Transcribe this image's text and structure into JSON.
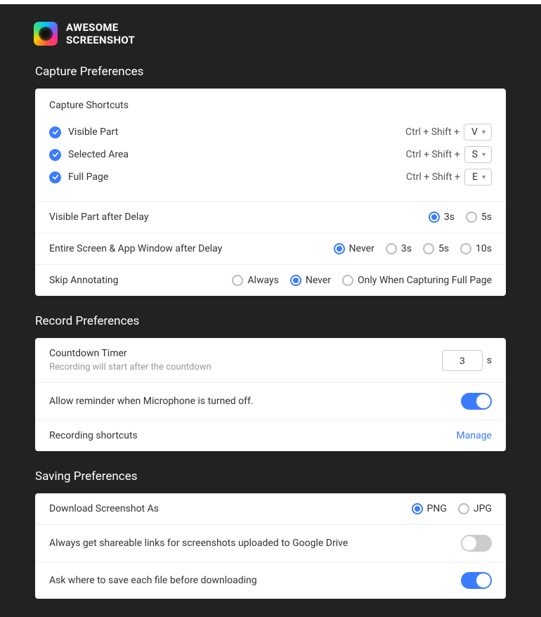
{
  "brand": {
    "line1": "AWESOME",
    "line2": "SCREENSHOT"
  },
  "capture": {
    "section_title": "Capture Preferences",
    "shortcuts_title": "Capture Shortcuts",
    "shortcut_prefix": "Ctrl + Shift +",
    "shortcuts": [
      {
        "label": "Visible Part",
        "key": "V",
        "enabled": true
      },
      {
        "label": "Selected Area",
        "key": "S",
        "enabled": true
      },
      {
        "label": "Full Page",
        "key": "E",
        "enabled": true
      }
    ],
    "visible_delay": {
      "label": "Visible Part after Delay",
      "options": [
        "3s",
        "5s"
      ],
      "selected": "3s"
    },
    "entire_delay": {
      "label": "Entire Screen & App Window after Delay",
      "options": [
        "Never",
        "3s",
        "5s",
        "10s"
      ],
      "selected": "Never"
    },
    "skip_annotating": {
      "label": "Skip Annotating",
      "options": [
        "Always",
        "Never",
        "Only When Capturing Full Page"
      ],
      "selected": "Never"
    }
  },
  "record": {
    "section_title": "Record Preferences",
    "countdown": {
      "label": "Countdown Timer",
      "sub": "Recording will start after the countdown",
      "value": "3",
      "unit": "s"
    },
    "mic_reminder": {
      "label": "Allow reminder when Microphone is turned off.",
      "on": true
    },
    "shortcuts": {
      "label": "Recording shortcuts",
      "action": "Manage"
    }
  },
  "saving": {
    "section_title": "Saving Preferences",
    "download_as": {
      "label": "Download Screenshot As",
      "options": [
        "PNG",
        "JPG"
      ],
      "selected": "PNG"
    },
    "drive_links": {
      "label": "Always get shareable links for screenshots uploaded to Google Drive",
      "on": false
    },
    "ask_where": {
      "label": "Ask where to save each file before downloading",
      "on": true
    }
  }
}
